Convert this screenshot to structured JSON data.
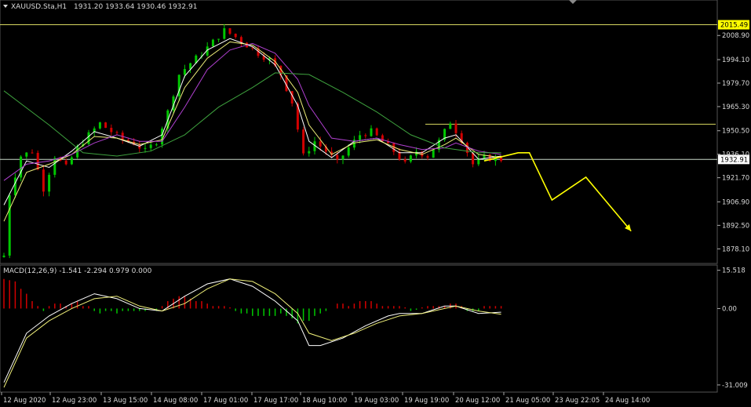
{
  "header": {
    "symbol": "XAUUSD.Sta,H1",
    "ohlc": "1931.20 1933.64 1930.46 1932.91"
  },
  "macd": {
    "label": "MACD(12,26,9) -1.541 -2.294 0.979 0.000"
  },
  "colors": {
    "background": "#000000",
    "bull_candle": "#00c800",
    "bear_candle": "#d20000",
    "ma_fast": "#ffffff",
    "ma_mid": "#f0f07a",
    "ma_purple": "#b040d0",
    "ma_slow": "#3ea23e",
    "forecast_arrow": "#ffff00",
    "price_line": "#c8d8c8"
  },
  "chart_data": [
    {
      "type": "candlestick",
      "title": "XAUUSD.Sta,H1",
      "ylim": [
        1872,
        2022
      ],
      "y_ticks": [
        2008.9,
        1994.1,
        1979.7,
        1965.3,
        1950.5,
        1936.1,
        1921.7,
        1906.9,
        1892.5,
        1878.1
      ],
      "x_ticks": [
        "12 Aug 2020",
        "12 Aug 23:00",
        "13 Aug 15:00",
        "14 Aug 08:00",
        "17 Aug 01:00",
        "17 Aug 17:00",
        "18 Aug 10:00",
        "19 Aug 03:00",
        "19 Aug 19:00",
        "20 Aug 12:00",
        "21 Aug 05:00",
        "23 Aug 22:05",
        "24 Aug 14:00"
      ],
      "current_price": 1932.91,
      "resistance_price": 2015.49,
      "horizontal_levels": [
        2015.49,
        1954.5,
        1932.91
      ],
      "close_path": [
        [
          0,
          1874
        ],
        [
          1,
          1912
        ],
        [
          3,
          1935
        ],
        [
          5,
          1938
        ],
        [
          7,
          1915
        ],
        [
          9,
          1935
        ],
        [
          11,
          1928
        ],
        [
          13,
          1940
        ],
        [
          15,
          1948
        ],
        [
          17,
          1955
        ],
        [
          19,
          1950
        ],
        [
          21,
          1945
        ],
        [
          23,
          1943
        ],
        [
          25,
          1938
        ],
        [
          27,
          1944
        ],
        [
          29,
          1962
        ],
        [
          31,
          1985
        ],
        [
          33,
          1992
        ],
        [
          35,
          1998
        ],
        [
          37,
          2005
        ],
        [
          39,
          2012
        ],
        [
          41,
          2008
        ],
        [
          43,
          2003
        ],
        [
          45,
          1998
        ],
        [
          47,
          1994
        ],
        [
          49,
          1985
        ],
        [
          51,
          1968
        ],
        [
          53,
          1935
        ],
        [
          55,
          1944
        ],
        [
          57,
          1938
        ],
        [
          59,
          1931
        ],
        [
          61,
          1940
        ],
        [
          63,
          1948
        ],
        [
          65,
          1950
        ],
        [
          67,
          1944
        ],
        [
          69,
          1938
        ],
        [
          71,
          1930
        ],
        [
          73,
          1938
        ],
        [
          75,
          1935
        ],
        [
          77,
          1944
        ],
        [
          79,
          1956
        ],
        [
          81,
          1945
        ],
        [
          83,
          1930
        ],
        [
          85,
          1934
        ],
        [
          88,
          1932.91
        ]
      ],
      "moving_averages": [
        {
          "color_key": "ma_fast",
          "path": [
            [
              0,
              1905
            ],
            [
              4,
              1932
            ],
            [
              8,
              1928
            ],
            [
              12,
              1938
            ],
            [
              16,
              1950
            ],
            [
              20,
              1946
            ],
            [
              24,
              1941
            ],
            [
              28,
              1948
            ],
            [
              32,
              1984
            ],
            [
              36,
              2000
            ],
            [
              40,
              2007
            ],
            [
              44,
              2002
            ],
            [
              48,
              1991
            ],
            [
              52,
              1966
            ],
            [
              54,
              1944
            ],
            [
              58,
              1934
            ],
            [
              62,
              1944
            ],
            [
              66,
              1946
            ],
            [
              70,
              1937
            ],
            [
              74,
              1937
            ],
            [
              78,
              1946
            ],
            [
              80,
              1948
            ],
            [
              84,
              1933
            ],
            [
              88,
              1935
            ]
          ]
        },
        {
          "color_key": "ma_mid",
          "path": [
            [
              0,
              1895
            ],
            [
              4,
              1925
            ],
            [
              8,
              1930
            ],
            [
              12,
              1936
            ],
            [
              16,
              1947
            ],
            [
              20,
              1946
            ],
            [
              24,
              1942
            ],
            [
              28,
              1945
            ],
            [
              32,
              1977
            ],
            [
              36,
              1995
            ],
            [
              40,
              2005
            ],
            [
              44,
              2003
            ],
            [
              48,
              1993
            ],
            [
              52,
              1974
            ],
            [
              54,
              1954
            ],
            [
              58,
              1936
            ],
            [
              62,
              1943
            ],
            [
              66,
              1945
            ],
            [
              70,
              1939
            ],
            [
              74,
              1936
            ],
            [
              78,
              1942
            ],
            [
              80,
              1946
            ],
            [
              84,
              1936
            ],
            [
              88,
              1934
            ]
          ]
        },
        {
          "color_key": "ma_purple",
          "path": [
            [
              0,
              1920
            ],
            [
              4,
              1930
            ],
            [
              8,
              1932
            ],
            [
              12,
              1936
            ],
            [
              16,
              1943
            ],
            [
              20,
              1948
            ],
            [
              24,
              1944
            ],
            [
              28,
              1944
            ],
            [
              32,
              1965
            ],
            [
              36,
              1988
            ],
            [
              40,
              2000
            ],
            [
              44,
              2004
            ],
            [
              48,
              1998
            ],
            [
              52,
              1982
            ],
            [
              54,
              1966
            ],
            [
              58,
              1946
            ],
            [
              62,
              1944
            ],
            [
              66,
              1946
            ],
            [
              70,
              1942
            ],
            [
              74,
              1939
            ],
            [
              78,
              1940
            ],
            [
              80,
              1943
            ],
            [
              84,
              1938
            ],
            [
              88,
              1936
            ]
          ]
        },
        {
          "color_key": "ma_slow",
          "path": [
            [
              0,
              1975
            ],
            [
              8,
              1954
            ],
            [
              14,
              1937
            ],
            [
              20,
              1935
            ],
            [
              26,
              1938
            ],
            [
              32,
              1948
            ],
            [
              38,
              1965
            ],
            [
              44,
              1977
            ],
            [
              48,
              1986
            ],
            [
              54,
              1985
            ],
            [
              60,
              1974
            ],
            [
              66,
              1962
            ],
            [
              72,
              1948
            ],
            [
              78,
              1940
            ],
            [
              84,
              1937
            ],
            [
              88,
              1937
            ]
          ]
        }
      ],
      "forecast_path": [
        [
          85,
          1932
        ],
        [
          91,
          1937
        ],
        [
          93,
          1937
        ],
        [
          97,
          1908
        ],
        [
          103,
          1922
        ],
        [
          111,
          1889
        ]
      ]
    },
    {
      "type": "bar",
      "title": "MACD(12,26,9)",
      "ylim": [
        -32,
        17
      ],
      "y_ticks": [
        15.518,
        0.0,
        -31.009
      ],
      "values_main": [
        [
          0,
          -30
        ],
        [
          4,
          -10
        ],
        [
          8,
          -3
        ],
        [
          12,
          2
        ],
        [
          16,
          6
        ],
        [
          20,
          4
        ],
        [
          24,
          0
        ],
        [
          28,
          -1
        ],
        [
          32,
          5
        ],
        [
          36,
          10
        ],
        [
          40,
          12
        ],
        [
          44,
          9
        ],
        [
          48,
          3
        ],
        [
          52,
          -5
        ],
        [
          54,
          -15
        ],
        [
          56,
          -15
        ],
        [
          60,
          -12
        ],
        [
          64,
          -7
        ],
        [
          68,
          -3
        ],
        [
          70,
          -2
        ],
        [
          74,
          -2
        ],
        [
          78,
          1
        ],
        [
          80,
          1
        ],
        [
          84,
          -2
        ],
        [
          88,
          -1.5
        ]
      ],
      "values_signal": [
        [
          0,
          -32
        ],
        [
          4,
          -12
        ],
        [
          8,
          -5
        ],
        [
          12,
          0
        ],
        [
          16,
          4
        ],
        [
          20,
          5
        ],
        [
          24,
          1
        ],
        [
          28,
          -1
        ],
        [
          32,
          2
        ],
        [
          36,
          8
        ],
        [
          40,
          12
        ],
        [
          44,
          11
        ],
        [
          48,
          6
        ],
        [
          52,
          -2
        ],
        [
          54,
          -10
        ],
        [
          58,
          -13
        ],
        [
          62,
          -10
        ],
        [
          66,
          -6
        ],
        [
          70,
          -3
        ],
        [
          74,
          -2
        ],
        [
          78,
          0
        ],
        [
          80,
          1
        ],
        [
          84,
          -1
        ],
        [
          88,
          -2.3
        ]
      ],
      "histogram": [
        [
          0,
          12
        ],
        [
          2,
          11
        ],
        [
          3,
          8
        ],
        [
          4,
          6
        ],
        [
          5,
          3
        ],
        [
          6,
          1
        ],
        [
          7,
          -1
        ],
        [
          8,
          1
        ],
        [
          9,
          2
        ],
        [
          10,
          2
        ],
        [
          11,
          1
        ],
        [
          12,
          2
        ],
        [
          13,
          3
        ],
        [
          14,
          1
        ],
        [
          15,
          1
        ],
        [
          16,
          -1
        ],
        [
          17,
          -2
        ],
        [
          18,
          -1
        ],
        [
          19,
          -1
        ],
        [
          20,
          -2
        ],
        [
          21,
          -1
        ],
        [
          22,
          -1
        ],
        [
          23,
          -1
        ],
        [
          24,
          -1
        ],
        [
          25,
          -1
        ],
        [
          26,
          0
        ],
        [
          27,
          -1
        ],
        [
          28,
          1
        ],
        [
          29,
          3
        ],
        [
          30,
          4
        ],
        [
          31,
          5
        ],
        [
          32,
          5
        ],
        [
          33,
          4
        ],
        [
          34,
          3
        ],
        [
          35,
          3
        ],
        [
          36,
          2
        ],
        [
          37,
          1
        ],
        [
          38,
          1
        ],
        [
          39,
          1
        ],
        [
          40,
          0.5
        ],
        [
          41,
          -1
        ],
        [
          42,
          -2
        ],
        [
          43,
          -2
        ],
        [
          44,
          -3
        ],
        [
          45,
          -3
        ],
        [
          46,
          -3
        ],
        [
          47,
          -3
        ],
        [
          48,
          -3
        ],
        [
          49,
          -2
        ],
        [
          50,
          -3
        ],
        [
          51,
          -4
        ],
        [
          52,
          -6
        ],
        [
          53,
          -5
        ],
        [
          54,
          -5
        ],
        [
          55,
          -3
        ],
        [
          56,
          -2
        ],
        [
          57,
          -1
        ],
        [
          58,
          0
        ],
        [
          59,
          2
        ],
        [
          60,
          2
        ],
        [
          61,
          1
        ],
        [
          62,
          2
        ],
        [
          63,
          3
        ],
        [
          64,
          3
        ],
        [
          65,
          3
        ],
        [
          66,
          2
        ],
        [
          67,
          1
        ],
        [
          68,
          1
        ],
        [
          69,
          1
        ],
        [
          70,
          1
        ],
        [
          71,
          0.5
        ],
        [
          72,
          -1
        ],
        [
          73,
          -0.5
        ],
        [
          74,
          0.5
        ],
        [
          75,
          1
        ],
        [
          76,
          1
        ],
        [
          77,
          1
        ],
        [
          78,
          1
        ],
        [
          79,
          2
        ],
        [
          80,
          2
        ],
        [
          81,
          1
        ],
        [
          82,
          -1
        ],
        [
          83,
          -1
        ],
        [
          84,
          -1
        ],
        [
          85,
          1
        ],
        [
          86,
          1
        ],
        [
          87,
          1
        ],
        [
          88,
          1
        ]
      ]
    }
  ]
}
